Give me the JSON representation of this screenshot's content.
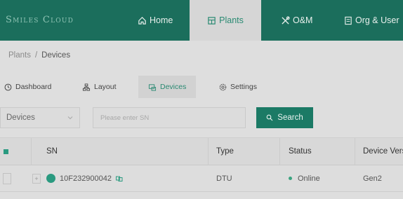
{
  "brand": {
    "logo_text": "Smiles Cloud",
    "accent": "#1b6e5c"
  },
  "nav": {
    "items": [
      {
        "label": "Home",
        "icon": "home-icon"
      },
      {
        "label": "Plants",
        "icon": "plants-icon",
        "active": true
      },
      {
        "label": "O&M",
        "icon": "tools-icon"
      },
      {
        "label": "Org & User",
        "icon": "org-icon"
      }
    ]
  },
  "breadcrumb": {
    "parent": "Plants",
    "separator": "/",
    "current": "Devices"
  },
  "tabs": [
    {
      "label": "Dashboard",
      "icon": "clock-icon"
    },
    {
      "label": "Layout",
      "icon": "layout-icon"
    },
    {
      "label": "Devices",
      "icon": "devices-icon",
      "active": true
    },
    {
      "label": "Settings",
      "icon": "gear-icon"
    }
  ],
  "filter": {
    "select_value": "Devices",
    "search_placeholder": "Please enter SN",
    "search_label": "Search"
  },
  "table": {
    "columns": [
      "SN",
      "Type",
      "Status",
      "Device Vers"
    ],
    "rows": [
      {
        "sn": "10F232900042",
        "type": "DTU",
        "status": "Online",
        "version": "Gen2"
      }
    ]
  }
}
